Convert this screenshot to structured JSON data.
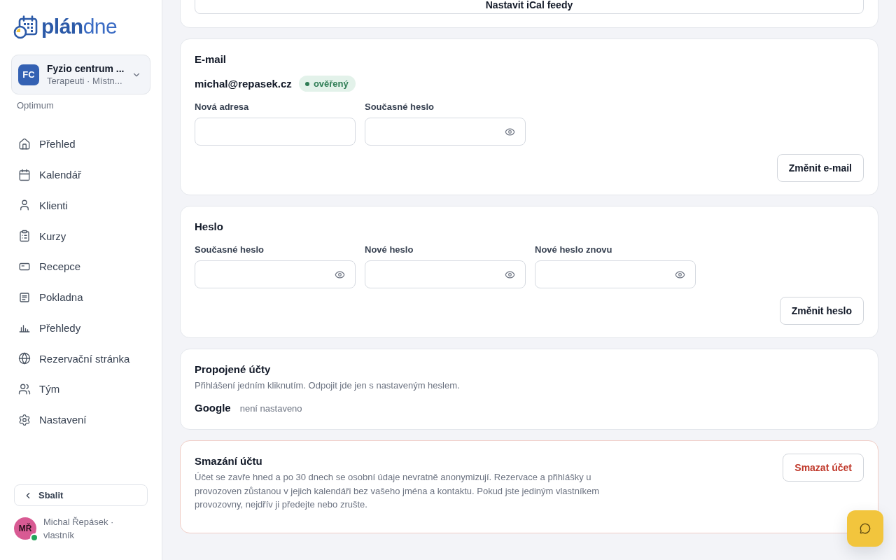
{
  "sidebar": {
    "logo": "**plán**dne",
    "org_switcher": {
      "initials": "FC",
      "name": "Fyzio centrum ...",
      "subtitle": "Terapeuti · Místn..."
    },
    "plan": "Optimum",
    "nav": [
      {
        "label": "Přehled",
        "selected": false
      },
      {
        "label": "Kalendář",
        "selected": false
      },
      {
        "label": "Klienti",
        "selected": false
      },
      {
        "label": "Kurzy",
        "selected": false
      },
      {
        "label": "Recepce",
        "selected": false
      },
      {
        "label": "Pokladna",
        "selected": false
      },
      {
        "label": "Přehledy",
        "selected": false
      },
      {
        "label": "Rezervační stránka",
        "selected": false
      },
      {
        "label": "Tým",
        "selected": false
      },
      {
        "label": "Nastavení",
        "selected": false
      }
    ],
    "collapse_button": "Sbalit",
    "user": {
      "initials": "MŘ",
      "name": "Michal Řepásek · vlastník",
      "online": true
    }
  },
  "ical": {
    "button": "Nastavit iCal feedy"
  },
  "email": {
    "title": "E-mail",
    "current": "michal@repasek.cz",
    "badge": "ověřený",
    "fields": [
      {
        "label": "Nová adresa",
        "kind": "text"
      },
      {
        "label": "Současné heslo",
        "kind": "password"
      }
    ],
    "button": "Změnit e-mail"
  },
  "password": {
    "title": "Heslo",
    "fields": [
      {
        "label": "Současné heslo",
        "kind": "password"
      },
      {
        "label": "Nové heslo",
        "kind": "password"
      },
      {
        "label": "Nové heslo znovu",
        "kind": "password"
      }
    ],
    "button": "Změnit heslo"
  },
  "linked_accounts": {
    "title": "Propojené účty",
    "description": "Přihlášení jedním kliknutím. Odpojit jde jen s nastaveným heslem.",
    "accounts": [
      {
        "name": "Google",
        "status": "není nastaveno"
      }
    ]
  },
  "delete_account": {
    "title": "Smazání účtu",
    "description": "Účet se zavře hned a po 30 dnech se osobní údaje nevratně anonymizují. Rezervace a přihlášky u provozoven zůstanou v jejich kalendáři bez vašeho jména a kontaktu. Pokud jste jediným vlastníkem provozovny, nejdřív ji předejte nebo zrušte.",
    "button": "Smazat účet"
  }
}
